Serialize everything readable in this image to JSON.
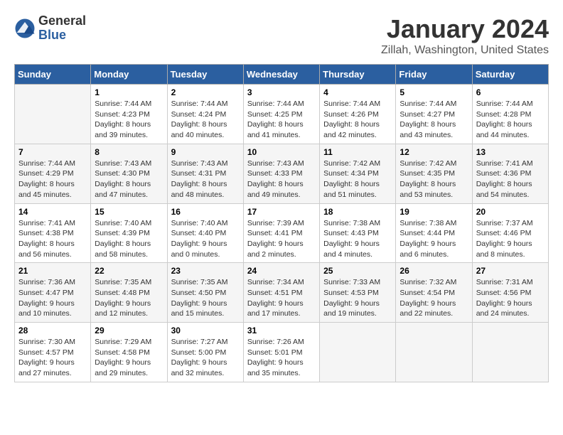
{
  "header": {
    "logo_general": "General",
    "logo_blue": "Blue",
    "title": "January 2024",
    "subtitle": "Zillah, Washington, United States"
  },
  "weekdays": [
    "Sunday",
    "Monday",
    "Tuesday",
    "Wednesday",
    "Thursday",
    "Friday",
    "Saturday"
  ],
  "weeks": [
    [
      {
        "day": null,
        "info": null
      },
      {
        "day": "1",
        "info": "Sunrise: 7:44 AM\nSunset: 4:23 PM\nDaylight: 8 hours\nand 39 minutes."
      },
      {
        "day": "2",
        "info": "Sunrise: 7:44 AM\nSunset: 4:24 PM\nDaylight: 8 hours\nand 40 minutes."
      },
      {
        "day": "3",
        "info": "Sunrise: 7:44 AM\nSunset: 4:25 PM\nDaylight: 8 hours\nand 41 minutes."
      },
      {
        "day": "4",
        "info": "Sunrise: 7:44 AM\nSunset: 4:26 PM\nDaylight: 8 hours\nand 42 minutes."
      },
      {
        "day": "5",
        "info": "Sunrise: 7:44 AM\nSunset: 4:27 PM\nDaylight: 8 hours\nand 43 minutes."
      },
      {
        "day": "6",
        "info": "Sunrise: 7:44 AM\nSunset: 4:28 PM\nDaylight: 8 hours\nand 44 minutes."
      }
    ],
    [
      {
        "day": "7",
        "info": "Sunrise: 7:44 AM\nSunset: 4:29 PM\nDaylight: 8 hours\nand 45 minutes."
      },
      {
        "day": "8",
        "info": "Sunrise: 7:43 AM\nSunset: 4:30 PM\nDaylight: 8 hours\nand 47 minutes."
      },
      {
        "day": "9",
        "info": "Sunrise: 7:43 AM\nSunset: 4:31 PM\nDaylight: 8 hours\nand 48 minutes."
      },
      {
        "day": "10",
        "info": "Sunrise: 7:43 AM\nSunset: 4:33 PM\nDaylight: 8 hours\nand 49 minutes."
      },
      {
        "day": "11",
        "info": "Sunrise: 7:42 AM\nSunset: 4:34 PM\nDaylight: 8 hours\nand 51 minutes."
      },
      {
        "day": "12",
        "info": "Sunrise: 7:42 AM\nSunset: 4:35 PM\nDaylight: 8 hours\nand 53 minutes."
      },
      {
        "day": "13",
        "info": "Sunrise: 7:41 AM\nSunset: 4:36 PM\nDaylight: 8 hours\nand 54 minutes."
      }
    ],
    [
      {
        "day": "14",
        "info": "Sunrise: 7:41 AM\nSunset: 4:38 PM\nDaylight: 8 hours\nand 56 minutes."
      },
      {
        "day": "15",
        "info": "Sunrise: 7:40 AM\nSunset: 4:39 PM\nDaylight: 8 hours\nand 58 minutes."
      },
      {
        "day": "16",
        "info": "Sunrise: 7:40 AM\nSunset: 4:40 PM\nDaylight: 9 hours\nand 0 minutes."
      },
      {
        "day": "17",
        "info": "Sunrise: 7:39 AM\nSunset: 4:41 PM\nDaylight: 9 hours\nand 2 minutes."
      },
      {
        "day": "18",
        "info": "Sunrise: 7:38 AM\nSunset: 4:43 PM\nDaylight: 9 hours\nand 4 minutes."
      },
      {
        "day": "19",
        "info": "Sunrise: 7:38 AM\nSunset: 4:44 PM\nDaylight: 9 hours\nand 6 minutes."
      },
      {
        "day": "20",
        "info": "Sunrise: 7:37 AM\nSunset: 4:46 PM\nDaylight: 9 hours\nand 8 minutes."
      }
    ],
    [
      {
        "day": "21",
        "info": "Sunrise: 7:36 AM\nSunset: 4:47 PM\nDaylight: 9 hours\nand 10 minutes."
      },
      {
        "day": "22",
        "info": "Sunrise: 7:35 AM\nSunset: 4:48 PM\nDaylight: 9 hours\nand 12 minutes."
      },
      {
        "day": "23",
        "info": "Sunrise: 7:35 AM\nSunset: 4:50 PM\nDaylight: 9 hours\nand 15 minutes."
      },
      {
        "day": "24",
        "info": "Sunrise: 7:34 AM\nSunset: 4:51 PM\nDaylight: 9 hours\nand 17 minutes."
      },
      {
        "day": "25",
        "info": "Sunrise: 7:33 AM\nSunset: 4:53 PM\nDaylight: 9 hours\nand 19 minutes."
      },
      {
        "day": "26",
        "info": "Sunrise: 7:32 AM\nSunset: 4:54 PM\nDaylight: 9 hours\nand 22 minutes."
      },
      {
        "day": "27",
        "info": "Sunrise: 7:31 AM\nSunset: 4:56 PM\nDaylight: 9 hours\nand 24 minutes."
      }
    ],
    [
      {
        "day": "28",
        "info": "Sunrise: 7:30 AM\nSunset: 4:57 PM\nDaylight: 9 hours\nand 27 minutes."
      },
      {
        "day": "29",
        "info": "Sunrise: 7:29 AM\nSunset: 4:58 PM\nDaylight: 9 hours\nand 29 minutes."
      },
      {
        "day": "30",
        "info": "Sunrise: 7:27 AM\nSunset: 5:00 PM\nDaylight: 9 hours\nand 32 minutes."
      },
      {
        "day": "31",
        "info": "Sunrise: 7:26 AM\nSunset: 5:01 PM\nDaylight: 9 hours\nand 35 minutes."
      },
      {
        "day": null,
        "info": null
      },
      {
        "day": null,
        "info": null
      },
      {
        "day": null,
        "info": null
      }
    ]
  ]
}
